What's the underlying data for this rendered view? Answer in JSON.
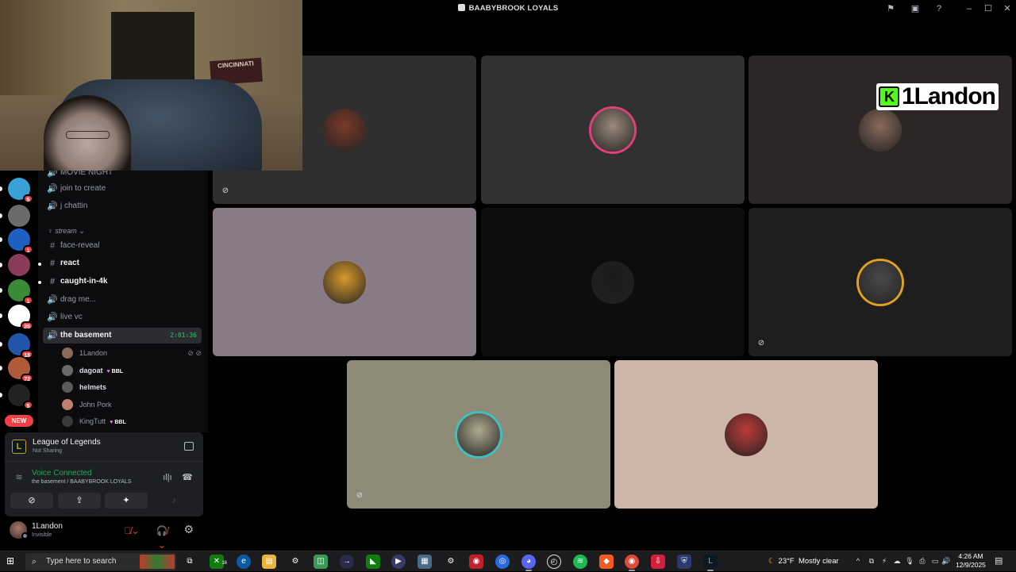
{
  "window": {
    "title": "BAABYBROOK LOYALS",
    "controls": [
      "minimize",
      "maximize",
      "close"
    ]
  },
  "servers": [
    {
      "name": "server-1",
      "badge": "5",
      "color": "#3aa0d8"
    },
    {
      "name": "server-2",
      "badge": "",
      "color": "#6b6b6b"
    },
    {
      "name": "server-3",
      "badge": "1",
      "color": "#1f5fbf"
    },
    {
      "name": "server-4",
      "badge": "",
      "color": "#8a3a5a"
    },
    {
      "name": "server-5",
      "badge": "1",
      "color": "#3a8a3a"
    },
    {
      "name": "server-6",
      "badge": "25",
      "color": "#ffffff"
    },
    {
      "name": "server-7",
      "badge": "18",
      "color": "#2255aa"
    },
    {
      "name": "server-8",
      "badge": "72",
      "color": "#b05a3a"
    },
    {
      "name": "server-9",
      "badge": "5",
      "color": "#222222"
    }
  ],
  "new_label": "NEW",
  "channels": {
    "partial_top": "MOVIE NIGHT",
    "voice_top": [
      {
        "label": "join to create"
      },
      {
        "label": "j chattin"
      }
    ],
    "category": "stream",
    "text": [
      {
        "label": "face-reveal",
        "unread": false
      },
      {
        "label": "react",
        "unread": true
      },
      {
        "label": "caught-in-4k",
        "unread": true
      }
    ],
    "voice": [
      {
        "label": "drag me..."
      },
      {
        "label": "live vc"
      }
    ],
    "active": {
      "label": "the basement",
      "timer": "2:01:36"
    },
    "members": [
      {
        "name": "1Landon",
        "tag": "",
        "bold": false,
        "color": "#8a6a5a"
      },
      {
        "name": "dagoat",
        "tag": "BBL",
        "bold": true,
        "color": "#6a6a6a"
      },
      {
        "name": "helmets",
        "tag": "",
        "bold": true,
        "color": "#5a5a5a"
      },
      {
        "name": "John Pork",
        "tag": "",
        "bold": false,
        "color": "#c08070"
      },
      {
        "name": "KingTutt",
        "tag": "BBL",
        "bold": false,
        "color": "#3a3a3a"
      }
    ]
  },
  "activity": {
    "game": "League of Legends",
    "status": "Not Sharing",
    "icon_letter": "L"
  },
  "voice_status": {
    "title": "Voice Connected",
    "location": "the basement / BAABYBROOK LOYALS"
  },
  "user": {
    "name": "1Landon",
    "status": "Invisible"
  },
  "webcam": {
    "poster_text": "CINCINNATI"
  },
  "overlay": {
    "icon_letter": "K",
    "name": "1Landon"
  },
  "tiles": [
    {
      "name": "tile-1",
      "bg": "#2f2f2f",
      "avatar": "#7a3a2a",
      "ring": "",
      "micoff": true
    },
    {
      "name": "tile-2",
      "bg": "#313131",
      "avatar": "#9a8a7a",
      "ring": "#e0407a",
      "micoff": false
    },
    {
      "name": "tile-3",
      "bg": "#2c2626",
      "avatar": "#8a6a5a",
      "ring": "",
      "micoff": false
    },
    {
      "name": "tile-4",
      "bg": "#897b86",
      "avatar": "#d89a2a",
      "ring": "",
      "micoff": false
    },
    {
      "name": "tile-5",
      "bg": "#0d0d0d",
      "avatar": "#1a1a1a",
      "ring": "",
      "micoff": false
    },
    {
      "name": "tile-6",
      "bg": "#1d1e1d",
      "avatar": "#4a4a4a",
      "ring": "#e0a020",
      "micoff": true
    },
    {
      "name": "tile-7",
      "bg": "#8d8b78",
      "avatar": "#b0aa90",
      "ring": "#40c0c0",
      "micoff": true
    },
    {
      "name": "tile-8",
      "bg": "#cbb6a8",
      "avatar": "#c03a3a",
      "ring": "",
      "micoff": false
    }
  ],
  "taskbar": {
    "search_placeholder": "Type here to search",
    "weather_temp": "23°F",
    "weather_text": "Mostly clear",
    "time": "4:26 AM",
    "date": "12/9/2025",
    "xbox_badge": "16"
  }
}
